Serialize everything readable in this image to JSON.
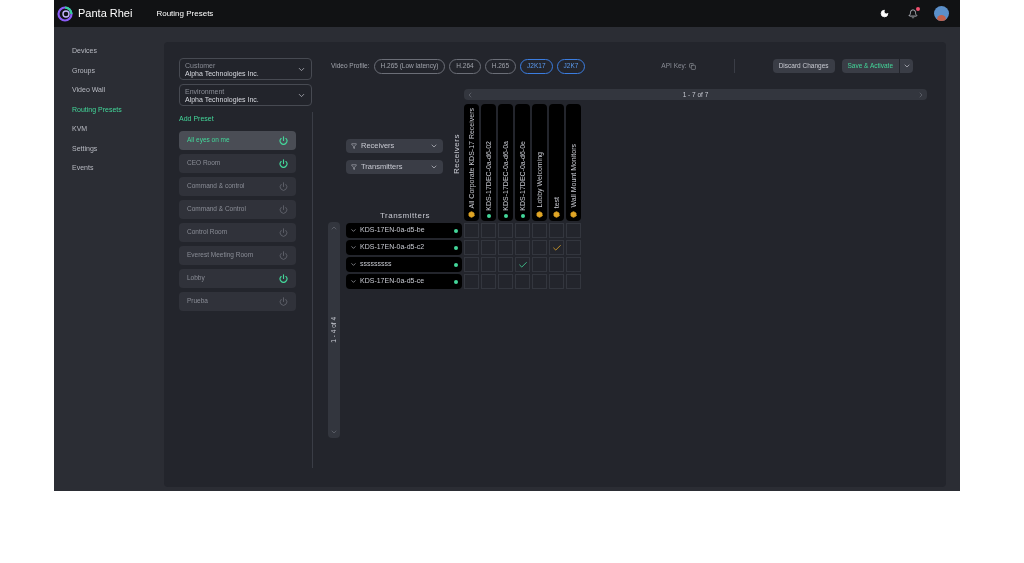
{
  "app": {
    "name": "Panta Rhei",
    "page_title": "Routing Presets"
  },
  "header": {
    "notification_unread": true
  },
  "nav": [
    {
      "label": "Devices",
      "selected": false
    },
    {
      "label": "Groups",
      "selected": false
    },
    {
      "label": "Video Wall",
      "selected": false
    },
    {
      "label": "Routing Presets",
      "selected": true
    },
    {
      "label": "KVM",
      "selected": false
    },
    {
      "label": "Settings",
      "selected": false
    },
    {
      "label": "Events",
      "selected": false
    }
  ],
  "customer": {
    "label": "Customer",
    "value": "Alpha Technologies Inc."
  },
  "environment": {
    "label": "Environment",
    "value": "Alpha Technologies Inc."
  },
  "add_preset": "Add Preset",
  "presets": [
    {
      "name": "All eyes on me",
      "selected": true,
      "active": true
    },
    {
      "name": "CEO Room",
      "selected": false,
      "active": true
    },
    {
      "name": "Command & control",
      "selected": false,
      "active": false
    },
    {
      "name": "Command & Control",
      "selected": false,
      "active": false
    },
    {
      "name": "Control Room",
      "selected": false,
      "active": false
    },
    {
      "name": "Everest Meeting Room",
      "selected": false,
      "active": false
    },
    {
      "name": "Lobby",
      "selected": false,
      "active": true
    },
    {
      "name": "Prueba",
      "selected": false,
      "active": false
    }
  ],
  "video_profile": {
    "label": "Video Profile:",
    "options": [
      {
        "label": "H.265 (Low latency)",
        "selected": false
      },
      {
        "label": "H.264",
        "selected": false
      },
      {
        "label": "H.265",
        "selected": false
      },
      {
        "label": "J2K17",
        "selected": true
      },
      {
        "label": "J2K7",
        "selected": true
      }
    ]
  },
  "api_key": {
    "label": "API Key:"
  },
  "buttons": {
    "discard": "Discard Changes",
    "save": "Save & Activate"
  },
  "receivers": {
    "title": "Receivers",
    "filter": "Receivers",
    "pagination": "1 - 7 of 7",
    "columns": [
      {
        "name": "All Corporate KDS-17 Receivers",
        "kind": "group"
      },
      {
        "name": "KDS-17DEC-0a-d6-02",
        "kind": "device"
      },
      {
        "name": "KDS-17DEC-0a-d6-0a",
        "kind": "device"
      },
      {
        "name": "KDS-17DEC-0a-d6-0e",
        "kind": "device"
      },
      {
        "name": "Lobby Welcoming",
        "kind": "group"
      },
      {
        "name": "test",
        "kind": "group"
      },
      {
        "name": "Wall Mount Monitors",
        "kind": "group"
      }
    ]
  },
  "transmitters": {
    "title": "Transmitters",
    "filter": "Transmitters",
    "pagination": "1 - 4 of 4",
    "rows": [
      {
        "name": "KDS-17EN-0a-d5-be",
        "online": true,
        "cells": [
          {
            "routed": false
          },
          {
            "routed": false
          },
          {
            "routed": false
          },
          {
            "routed": false
          },
          {
            "routed": false
          },
          {
            "routed": false
          },
          {
            "routed": false
          }
        ]
      },
      {
        "name": "KDS-17EN-0a-d5-c2",
        "online": true,
        "cells": [
          {
            "routed": false
          },
          {
            "routed": false
          },
          {
            "routed": false
          },
          {
            "routed": false
          },
          {
            "routed": false
          },
          {
            "routed": true
          },
          {
            "routed": false
          }
        ]
      },
      {
        "name": "sssssssss",
        "online": true,
        "cells": [
          {
            "routed": false
          },
          {
            "routed": false
          },
          {
            "routed": false
          },
          {
            "routed": true
          },
          {
            "routed": false
          },
          {
            "routed": false
          },
          {
            "routed": false
          }
        ]
      },
      {
        "name": "KDS-17EN-0a-d5-ce",
        "online": true,
        "cells": [
          {
            "routed": false
          },
          {
            "routed": false
          },
          {
            "routed": false
          },
          {
            "routed": false
          },
          {
            "routed": false
          },
          {
            "routed": false
          },
          {
            "routed": false
          }
        ]
      }
    ]
  }
}
